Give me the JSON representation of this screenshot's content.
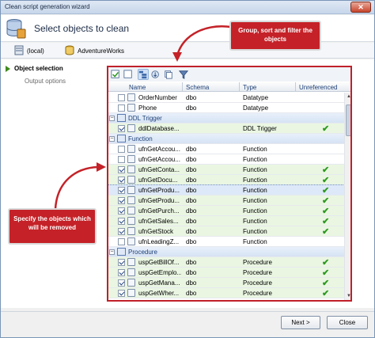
{
  "window": {
    "title": "Clean script generation wizard",
    "close_icon": "close-icon"
  },
  "header": {
    "title": "Select objects to clean",
    "icon": "database-cleanup-icon"
  },
  "connection": {
    "server": "(local)",
    "database": "AdventureWorks"
  },
  "sidebar": {
    "items": [
      {
        "label": "Object selection",
        "active": true
      },
      {
        "label": "Output options",
        "active": false
      }
    ]
  },
  "toolbar": {
    "buttons": [
      "check-all-icon",
      "uncheck-all-icon",
      "group-icon",
      "sort-icon",
      "view-icon",
      "filter-icon"
    ]
  },
  "grid": {
    "columns": [
      "Name",
      "Schema",
      "Type",
      "Unreferenced"
    ],
    "rows": [
      {
        "kind": "item",
        "name": "OrderNumber",
        "schema": "dbo",
        "type": "Datatype",
        "checked": false,
        "unref": false
      },
      {
        "kind": "item",
        "name": "Phone",
        "schema": "dbo",
        "type": "Datatype",
        "checked": false,
        "unref": false
      },
      {
        "kind": "group",
        "name": "DDL Trigger"
      },
      {
        "kind": "item",
        "name": "ddlDatabase...",
        "schema": "",
        "type": "DDL Trigger",
        "checked": true,
        "unref": true
      },
      {
        "kind": "group",
        "name": "Function"
      },
      {
        "kind": "item",
        "name": "ufnGetAccou...",
        "schema": "dbo",
        "type": "Function",
        "checked": false,
        "unref": false
      },
      {
        "kind": "item",
        "name": "ufnGetAccou...",
        "schema": "dbo",
        "type": "Function",
        "checked": false,
        "unref": false
      },
      {
        "kind": "item",
        "name": "ufnGetConta...",
        "schema": "dbo",
        "type": "Function",
        "checked": true,
        "unref": true
      },
      {
        "kind": "item",
        "name": "ufnGetDocu...",
        "schema": "dbo",
        "type": "Function",
        "checked": true,
        "unref": true
      },
      {
        "kind": "item",
        "name": "ufnGetProdu...",
        "schema": "dbo",
        "type": "Function",
        "checked": true,
        "unref": true,
        "selected": true
      },
      {
        "kind": "item",
        "name": "ufnGetProdu...",
        "schema": "dbo",
        "type": "Function",
        "checked": true,
        "unref": true
      },
      {
        "kind": "item",
        "name": "ufnGetPurch...",
        "schema": "dbo",
        "type": "Function",
        "checked": true,
        "unref": true
      },
      {
        "kind": "item",
        "name": "ufnGetSales...",
        "schema": "dbo",
        "type": "Function",
        "checked": true,
        "unref": true
      },
      {
        "kind": "item",
        "name": "ufnGetStock",
        "schema": "dbo",
        "type": "Function",
        "checked": true,
        "unref": true
      },
      {
        "kind": "item",
        "name": "ufnLeadingZ...",
        "schema": "dbo",
        "type": "Function",
        "checked": false,
        "unref": false
      },
      {
        "kind": "group",
        "name": "Procedure"
      },
      {
        "kind": "item",
        "name": "uspGetBillOf...",
        "schema": "dbo",
        "type": "Procedure",
        "checked": true,
        "unref": true
      },
      {
        "kind": "item",
        "name": "uspGetEmplo...",
        "schema": "dbo",
        "type": "Procedure",
        "checked": true,
        "unref": true
      },
      {
        "kind": "item",
        "name": "uspGetMana...",
        "schema": "dbo",
        "type": "Procedure",
        "checked": true,
        "unref": true
      },
      {
        "kind": "item",
        "name": "uspGetWher...",
        "schema": "dbo",
        "type": "Procedure",
        "checked": true,
        "unref": true
      }
    ]
  },
  "callouts": {
    "top": "Group, sort and filter the objects",
    "left": "Specify the objects which will be removed"
  },
  "buttons": {
    "next": "Next >",
    "cancel": "Close"
  },
  "colors": {
    "callout": "#c42228",
    "unreferenced_row": "#eaf6e2",
    "check": "#2d9a20"
  }
}
